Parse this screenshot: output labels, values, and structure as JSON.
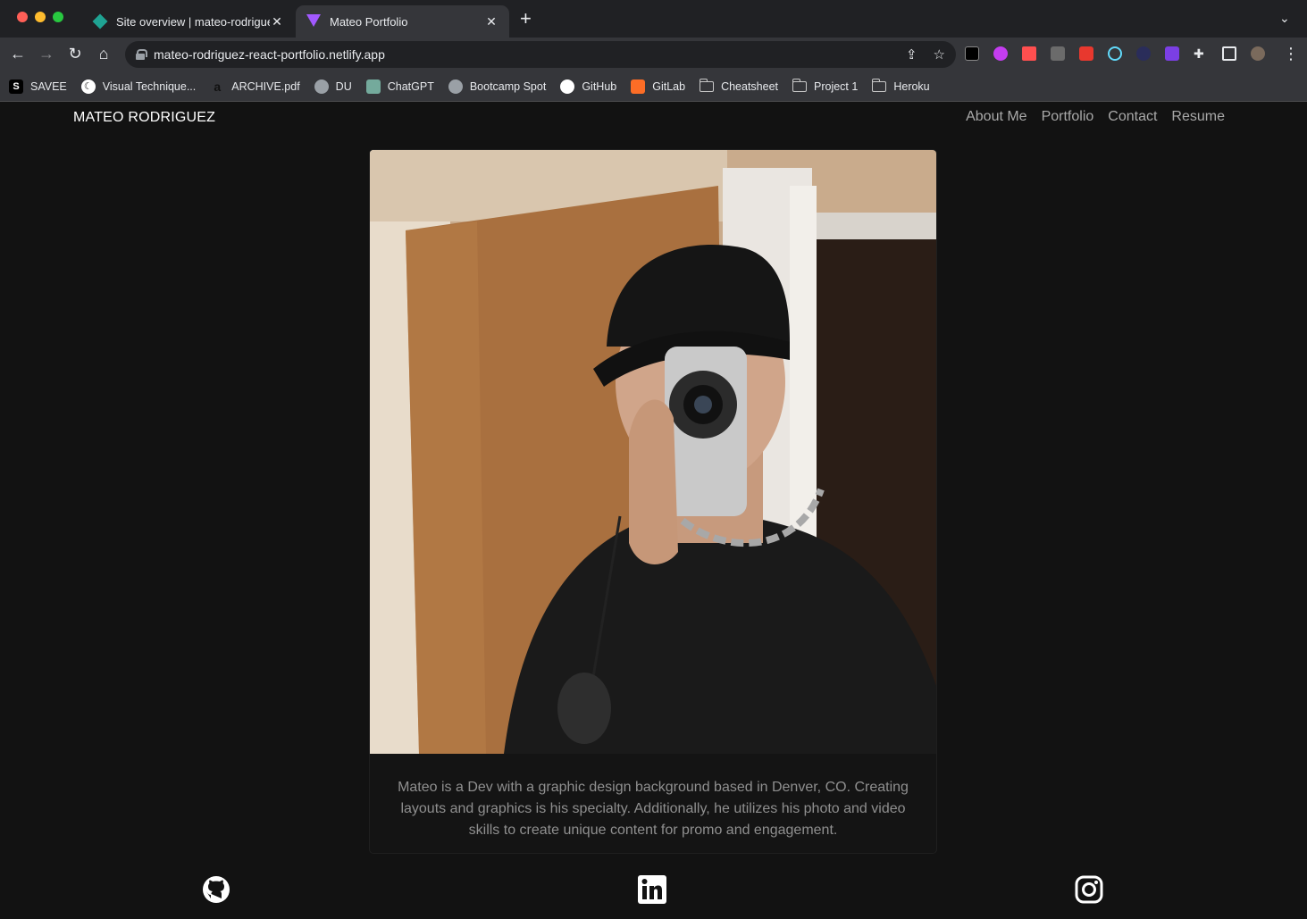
{
  "browser": {
    "tabs": [
      {
        "title": "Site overview | mateo-rodriguez",
        "active": false
      },
      {
        "title": "Mateo Portfolio",
        "active": true
      }
    ],
    "url": "mateo-rodriguez-react-portfolio.netlify.app",
    "bookmarks": [
      {
        "label": "SAVEE",
        "icon": "savee-icon"
      },
      {
        "label": "Visual Technique...",
        "icon": "moon-icon"
      },
      {
        "label": "ARCHIVE.pdf",
        "icon": "amazon-icon"
      },
      {
        "label": "DU",
        "icon": "globe-icon"
      },
      {
        "label": "ChatGPT",
        "icon": "chatgpt-icon"
      },
      {
        "label": "Bootcamp Spot",
        "icon": "globe-icon"
      },
      {
        "label": "GitHub",
        "icon": "github-icon"
      },
      {
        "label": "GitLab",
        "icon": "gitlab-icon"
      },
      {
        "label": "Cheatsheet",
        "icon": "folder-icon"
      },
      {
        "label": "Project 1",
        "icon": "folder-icon"
      },
      {
        "label": "Heroku",
        "icon": "folder-icon"
      }
    ]
  },
  "site": {
    "brand": "MATEO RODRIGUEZ",
    "nav": [
      "About Me",
      "Portfolio",
      "Contact",
      "Resume"
    ],
    "bio": "Mateo is a Dev with a graphic design background based in Denver, CO. Creating layouts and graphics is his specialty. Additionally, he utilizes his photo and video skills to create unique content for promo and engagement.",
    "social": [
      "github-icon",
      "linkedin-icon",
      "instagram-icon"
    ]
  }
}
